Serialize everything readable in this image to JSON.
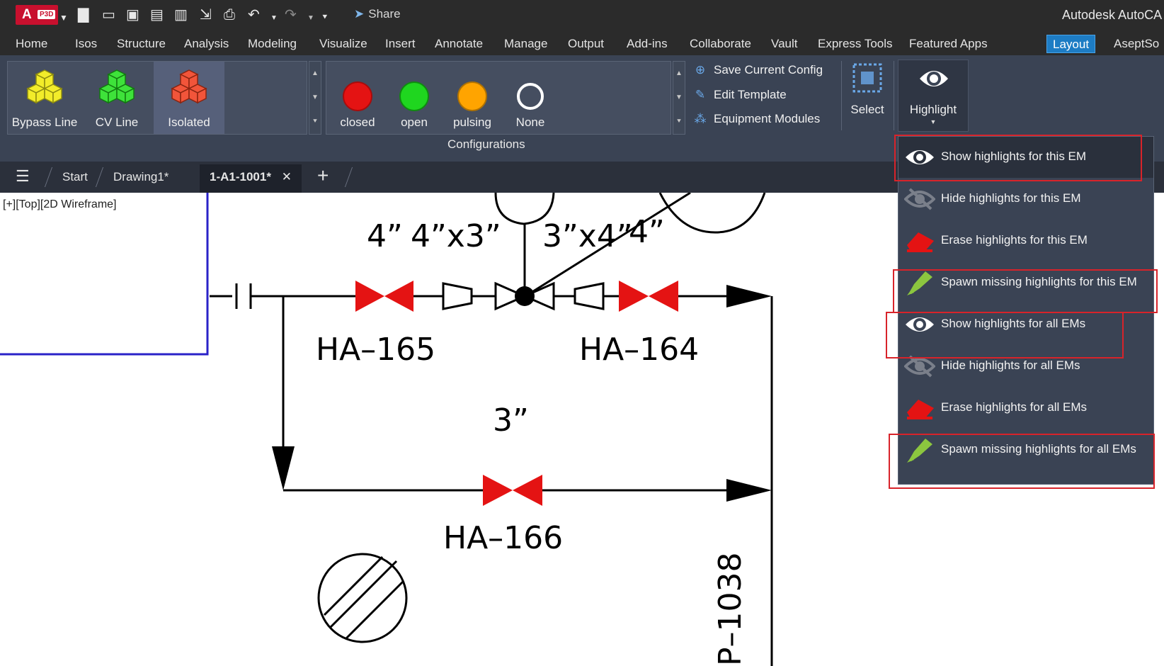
{
  "titlebar": {
    "logo_letter": "A",
    "logo_badge": "P3D",
    "share": "Share",
    "app_title": "Autodesk AutoCA"
  },
  "ribbon_tabs": [
    "Home",
    "Isos",
    "Structure",
    "Analysis",
    "Modeling",
    "Visualize",
    "Insert",
    "Annotate",
    "Manage",
    "Output",
    "Add-ins",
    "Collaborate",
    "Vault",
    "Express Tools",
    "Featured Apps",
    "Layout",
    "AseptSo"
  ],
  "active_tab": "Layout",
  "gallery_lines": [
    {
      "label": "Bypass Line",
      "color": "#f2ec2a"
    },
    {
      "label": "CV Line",
      "color": "#3ee23a"
    },
    {
      "label": "Isolated",
      "color": "#f2553a"
    }
  ],
  "gallery_states": [
    {
      "label": "closed",
      "color": "#e41313"
    },
    {
      "label": "open",
      "color": "#1fd61f"
    },
    {
      "label": "pulsing",
      "color": "#ffa400"
    },
    {
      "label": "None",
      "color": "none"
    }
  ],
  "side_commands": [
    {
      "label": "Save Current Config",
      "icon": "plus-circle-icon"
    },
    {
      "label": "Edit Template",
      "icon": "edit-icon"
    },
    {
      "label": "Equipment Modules",
      "icon": "modules-icon"
    }
  ],
  "panel_title": "Configurations",
  "select_label": "Select",
  "highlight_label": "Highlight",
  "doc_tabs": {
    "start": "Start",
    "drawing1": "Drawing1*",
    "current": "1-A1-1001*"
  },
  "viewport_label": "[+][Top][2D Wireframe]",
  "highlight_menu": [
    {
      "label": "Show highlights for this EM",
      "icon": "eye-icon"
    },
    {
      "label": "Hide highlights for this EM",
      "icon": "eye-slash-icon"
    },
    {
      "label": "Erase highlights for this EM",
      "icon": "eraser-icon"
    },
    {
      "label": "Spawn missing highlights for this EM",
      "icon": "highlighter-icon"
    },
    {
      "label": "Show highlights for all EMs",
      "icon": "eye-icon"
    },
    {
      "label": "Hide highlights for all EMs",
      "icon": "eye-slash-icon"
    },
    {
      "label": "Erase highlights for all EMs",
      "icon": "eraser-icon"
    },
    {
      "label": "Spawn missing highlights for all EMs",
      "icon": "highlighter-icon"
    }
  ],
  "drawing_text": {
    "size_4": "4”",
    "size_4x3": "4”x3”",
    "size_3x4": "3”x4”",
    "size_4b": "4”",
    "size_3": "3”",
    "valve_165": "HA–165",
    "valve_164": "HA–164",
    "valve_166": "HA–166",
    "pipe_1038": "P–1038"
  },
  "colors": {
    "valve_red": "#e41313",
    "accent": "#1d7cc4",
    "annotation_box": "#d8232a",
    "drawing_line_blue": "#2a22c8"
  }
}
